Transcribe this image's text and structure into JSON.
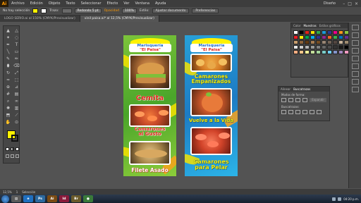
{
  "app": {
    "logo": "Ai",
    "menus": [
      "Archivo",
      "Edición",
      "Objeto",
      "Texto",
      "Seleccionar",
      "Efecto",
      "Ver",
      "Ventana",
      "Ayuda"
    ],
    "user": "Diseño"
  },
  "controlbar": {
    "selection_label": "No hay selección",
    "fill_color": "#fff200",
    "stroke_label": "Trazo:",
    "stroke_value": "",
    "brush": "Redondo 5 pt",
    "opacity_label": "Opacidad",
    "opacity_value": "100%",
    "style_label": "Estilo:",
    "btn_doc": "Ajustar documento",
    "btn_prefs": "Preferencias"
  },
  "tabs": [
    {
      "label": "LOGO SERIO.ai al 150% (CMYK/Previsualizar)",
      "active": false
    },
    {
      "label": "vinil paisa.ai* al 12,5% (CMYK/Previsualizar)",
      "active": true
    }
  ],
  "card1": {
    "logo_line1": "Marisquería",
    "logo_line2": "\"El Paisa\"",
    "item1": "Cemita",
    "item2a": "Camarones",
    "item2b": "al Gusto",
    "item3": "Filete Asado",
    "bg_color": "#5cb02e"
  },
  "card2": {
    "logo_line1": "Marisquería",
    "logo_line2": "\"El Paisa\"",
    "item1a": "Camarones",
    "item1b": "Empanizados",
    "item2": "Vuelve a la Vida",
    "item3a": "Camarones",
    "item3b": "para Pelar",
    "bg_color": "#1f8ccf"
  },
  "swatches_panel": {
    "tabs": [
      "Color",
      "Muestras",
      "Estilos gráficos"
    ]
  },
  "pathfinder_panel": {
    "tabs": [
      "Alinear",
      "Buscatrazos"
    ],
    "modes_label": "Modos de forma:",
    "finders_label": "Buscatrazos:",
    "expand_label": "Expandir"
  },
  "statusbar": {
    "zoom": "12,5%",
    "page": "1",
    "tool": "Selección"
  },
  "taskbar": {
    "time": "04:20 p.m.",
    "date": "",
    "apps": [
      "Ps",
      "Ai",
      "Id",
      "Br"
    ]
  }
}
